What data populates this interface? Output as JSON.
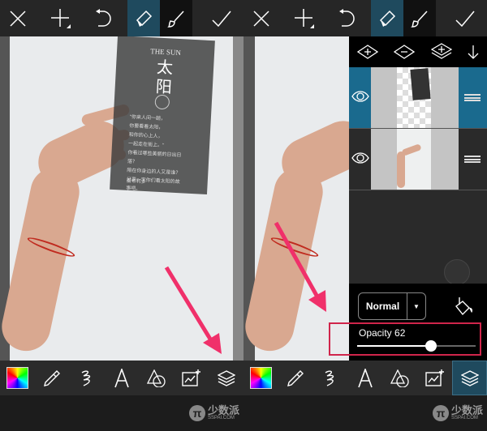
{
  "top_toolbar": {
    "icons": [
      "close-icon",
      "add-icon",
      "undo-icon",
      "eraser-icon",
      "brush-icon",
      "checkmark-icon"
    ],
    "active": "eraser-icon"
  },
  "bottom_toolbar": {
    "icons": [
      "color-picker-icon",
      "eyedropper-icon",
      "stroke-icon",
      "text-icon",
      "shapes-icon",
      "add-sticker-icon",
      "layers-icon"
    ]
  },
  "left_screen": {
    "card": {
      "title_en": "THE SUN",
      "title_zh_1": "太",
      "title_zh_2": "阳",
      "body": [
        "\"你来人间一趟，",
        "你要看看太阳，",
        "和你的心上人，",
        "一起走在街上。\"",
        "你看过哪些美丽的日出日",
        "落？",
        "陪在你身边的人又是谁？",
        "分享一字你们看太阳的故",
        "事吧。"
      ],
      "footer": "蛋布利多"
    }
  },
  "right_screen": {
    "layers_panel": {
      "actions": [
        "add-layer-icon",
        "remove-layer-icon",
        "merge-layer-icon",
        "move-down-icon"
      ],
      "layers": [
        {
          "visible": true,
          "selected": true
        },
        {
          "visible": true,
          "selected": false
        }
      ]
    },
    "blend_mode": "Normal",
    "opacity_label": "Opacity 62",
    "opacity_value": 62,
    "highlight_color": "#d0254b"
  },
  "annotation_arrow_color": "#f0306a",
  "accent_color": "#1f4a5e",
  "watermark": {
    "name": "少数派",
    "domain": "SSPAI.COM",
    "logo": "π"
  }
}
